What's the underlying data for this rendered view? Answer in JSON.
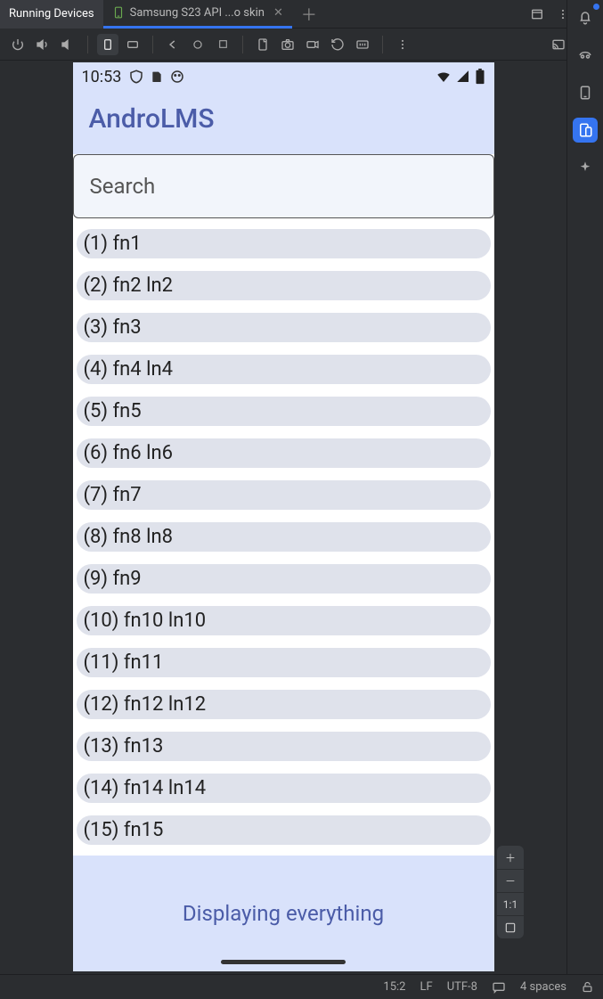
{
  "tabs": {
    "primary": "Running Devices",
    "secondary": "Samsung S23 API ...o skin"
  },
  "emulator": {
    "time": "10:53",
    "app_title": "AndroLMS",
    "search_placeholder": "Search",
    "footer": "Displaying everything",
    "items": [
      "(1) fn1",
      "(2) fn2 ln2",
      "(3) fn3",
      "(4) fn4 ln4",
      "(5) fn5",
      "(6) fn6 ln6",
      "(7) fn7",
      "(8) fn8 ln8",
      "(9) fn9",
      "(10) fn10 ln10",
      "(11) fn11",
      "(12) fn12 ln12",
      "(13) fn13",
      "(14) fn14 ln14",
      "(15) fn15"
    ]
  },
  "zoom": {
    "one_to_one": "1:1"
  },
  "status": {
    "pos": "15:2",
    "eol": "LF",
    "enc": "UTF-8",
    "indent": "4 spaces"
  }
}
